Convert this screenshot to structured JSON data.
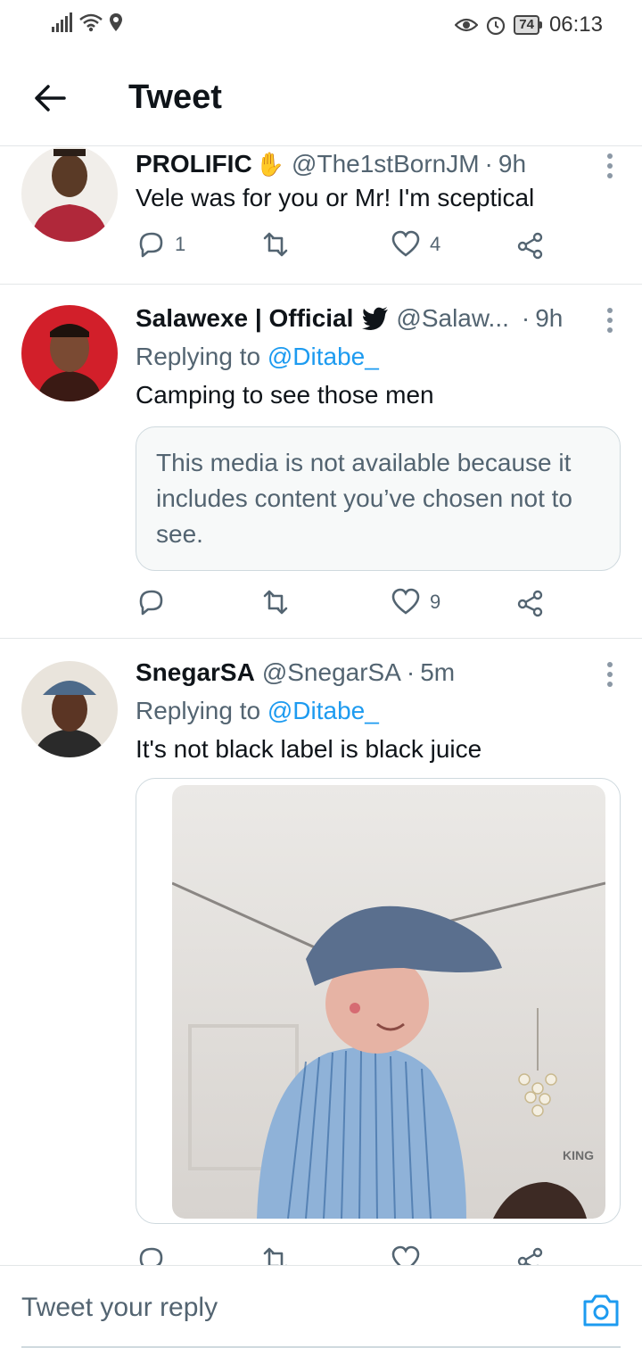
{
  "status_bar": {
    "battery": "74",
    "time": "06:13"
  },
  "header": {
    "title": "Tweet"
  },
  "tweets": [
    {
      "name": "PROLIFIC",
      "handle": "@The1stBornJM",
      "separator": "·",
      "time": "9h",
      "text": "Vele was for you or Mr! I'm sceptical",
      "replies": "1",
      "retweets": "",
      "likes": "4"
    },
    {
      "name": "Salawexe | Official",
      "handle": "@Salaw...",
      "separator": "·",
      "time": "9h",
      "replying_prefix": "Replying to",
      "replying_to": "@Ditabe_",
      "text": "Camping to see those men",
      "media_notice": "This media is not available because it includes content you’ve chosen not to see.",
      "replies": "",
      "retweets": "",
      "likes": "9"
    },
    {
      "name": "SnegarSA",
      "handle": "@SnegarSA",
      "separator": "·",
      "time": "5m",
      "replying_prefix": "Replying to",
      "replying_to": "@Ditabe_",
      "text": "It's not black label is black juice"
    }
  ],
  "reply_bar": {
    "placeholder": "Tweet your reply"
  },
  "colors": {
    "accent": "#1d9bf0",
    "secondary_text": "#536471",
    "border": "#cfd9de"
  }
}
